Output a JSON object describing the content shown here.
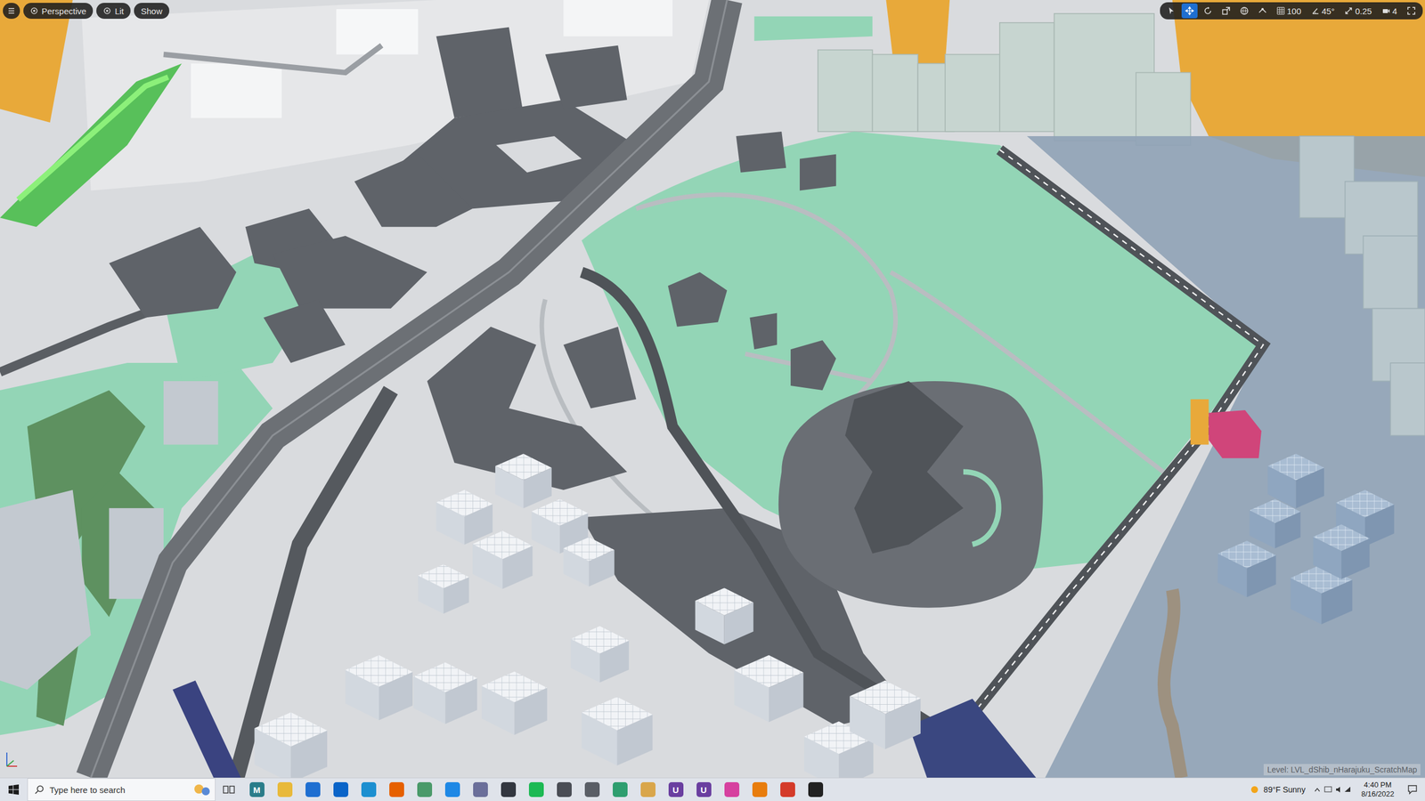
{
  "viewport": {
    "menu_button": {
      "label_hidden": true
    },
    "toolbar_buttons": [
      {
        "label": "Perspective",
        "has_icon": true
      },
      {
        "label": "Lit",
        "has_icon": true
      },
      {
        "label": "Show",
        "has_icon": false
      }
    ],
    "transform_tools": [
      {
        "kind": "select",
        "selected": false
      },
      {
        "kind": "translate",
        "selected": true
      },
      {
        "kind": "rotate",
        "selected": false
      },
      {
        "kind": "scale",
        "selected": false
      },
      {
        "kind": "world",
        "selected": false
      },
      {
        "kind": "surface",
        "selected": false
      }
    ],
    "snap_values": [
      {
        "kind": "grid",
        "label": "100"
      },
      {
        "kind": "angle",
        "label": "45°"
      },
      {
        "kind": "scale",
        "label": "0.25"
      },
      {
        "kind": "camera",
        "label": "4"
      }
    ],
    "level_label": "Level: LVL_dShib_nHarajuku_ScratchMap"
  },
  "taskbar": {
    "search_placeholder": "Type here to search",
    "apps": [
      {
        "color": "#2a7d8a",
        "glyph": "M"
      },
      {
        "color": "#e8b93a"
      },
      {
        "color": "#1f6fd1"
      },
      {
        "color": "#0a64c8"
      },
      {
        "color": "#1c8fd0"
      },
      {
        "color": "#e66000"
      },
      {
        "color": "#4a9a6a"
      },
      {
        "color": "#1e88e5"
      },
      {
        "color": "#6b6f9a"
      },
      {
        "color": "#333740"
      },
      {
        "color": "#1db954"
      },
      {
        "color": "#4a4d55"
      },
      {
        "color": "#5a5e66"
      },
      {
        "color": "#2e9e6f"
      },
      {
        "color": "#d9a64b"
      },
      {
        "color": "#6a3fa0",
        "glyph": "U"
      },
      {
        "color": "#6a3fa0",
        "glyph": "U"
      },
      {
        "color": "#d6409f"
      },
      {
        "color": "#e87d0d"
      },
      {
        "color": "#d43b2a"
      },
      {
        "color": "#222222"
      }
    ],
    "weather": "89°F Sunny",
    "time": "4:40 PM",
    "date": "8/16/2022"
  }
}
